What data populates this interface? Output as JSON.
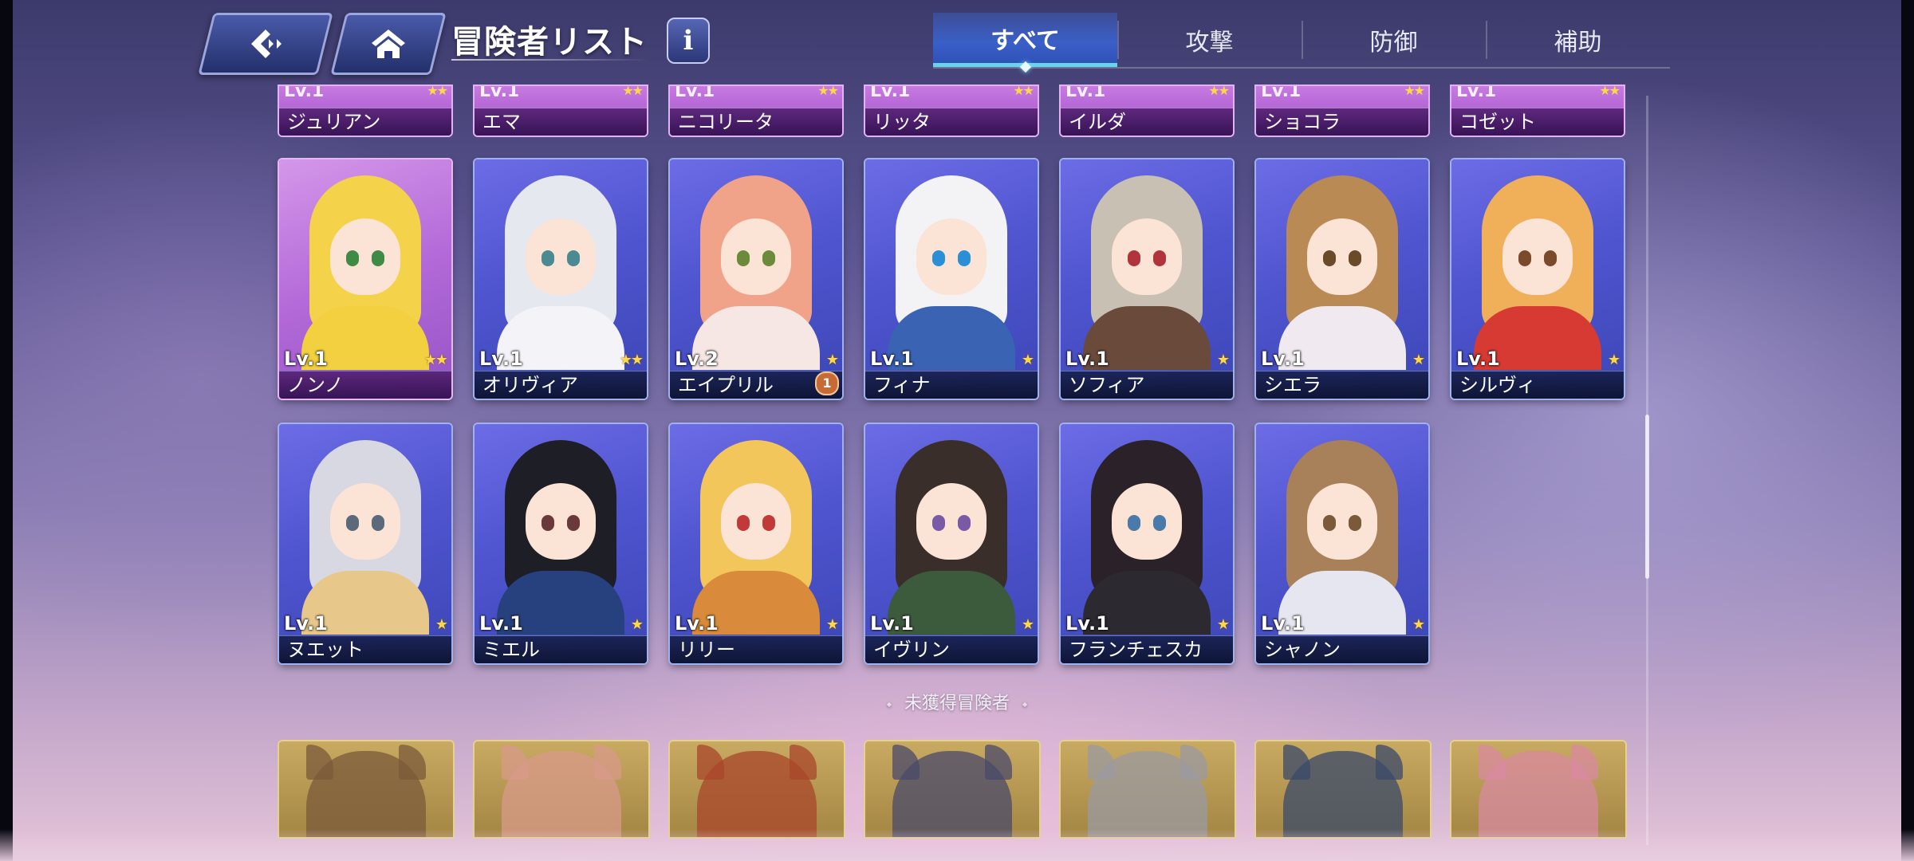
{
  "header": {
    "title": "冒険者リスト",
    "info_label": "i",
    "tabs": [
      {
        "label": "すべて",
        "active": true
      },
      {
        "label": "攻撃",
        "active": false
      },
      {
        "label": "防御",
        "active": false
      },
      {
        "label": "補助",
        "active": false
      }
    ]
  },
  "partial_row": [
    {
      "name": "ジュリアン",
      "level": "Lv.1",
      "stars": "★★"
    },
    {
      "name": "エマ",
      "level": "Lv.1",
      "stars": "★★"
    },
    {
      "name": "ニコリータ",
      "level": "Lv.1",
      "stars": "★★"
    },
    {
      "name": "リッタ",
      "level": "Lv.1",
      "stars": "★★"
    },
    {
      "name": "イルダ",
      "level": "Lv.1",
      "stars": "★★"
    },
    {
      "name": "ショコラ",
      "level": "Lv.1",
      "stars": "★★"
    },
    {
      "name": "コゼット",
      "level": "Lv.1",
      "stars": "★★"
    }
  ],
  "row1": [
    {
      "name": "ノンノ",
      "level": "Lv.1",
      "stars": "★★",
      "hair": "#f4d24a",
      "eye": "#3f8a44",
      "outfit": "#f2d040"
    },
    {
      "name": "オリヴィア",
      "level": "Lv.1",
      "stars": "★★",
      "hair": "#e6e8ef",
      "eye": "#4a8a92",
      "outfit": "#f4f4f8"
    },
    {
      "name": "エイプリル",
      "level": "Lv.2",
      "stars": "★",
      "badge": "1",
      "hair": "#f1a38a",
      "eye": "#6b8a3c",
      "outfit": "#f6e6e4"
    },
    {
      "name": "フィナ",
      "level": "Lv.1",
      "stars": "★",
      "hair": "#f3f3f6",
      "eye": "#2a8fd6",
      "outfit": "#3a63b4"
    },
    {
      "name": "ソフィア",
      "level": "Lv.1",
      "stars": "★",
      "hair": "#c9c0b4",
      "eye": "#b0343a",
      "outfit": "#6a4a3a"
    },
    {
      "name": "シエラ",
      "level": "Lv.1",
      "stars": "★",
      "hair": "#b98a54",
      "eye": "#6a4a28",
      "outfit": "#f0eaf0"
    },
    {
      "name": "シルヴィ",
      "level": "Lv.1",
      "stars": "★",
      "hair": "#f0b05a",
      "eye": "#7a4a2a",
      "outfit": "#d63a32"
    }
  ],
  "row2": [
    {
      "name": "ヌエット",
      "level": "Lv.1",
      "stars": "★",
      "hair": "#d8d8e2",
      "eye": "#5a6a7a",
      "outfit": "#e8c88a"
    },
    {
      "name": "ミエル",
      "level": "Lv.1",
      "stars": "★",
      "hair": "#1e1e26",
      "eye": "#6a3a3a",
      "outfit": "#27407e"
    },
    {
      "name": "リリー",
      "level": "Lv.1",
      "stars": "★",
      "hair": "#f2c65a",
      "eye": "#c03a3a",
      "outfit": "#d98a3a"
    },
    {
      "name": "イヴリン",
      "level": "Lv.1",
      "stars": "★",
      "hair": "#3a2e2a",
      "eye": "#7a5aa8",
      "outfit": "#3c5a3c"
    },
    {
      "name": "フランチェスカ",
      "level": "Lv.1",
      "stars": "★",
      "hair": "#2a2228",
      "eye": "#4a7aa8",
      "outfit": "#2c2a30"
    },
    {
      "name": "シャノン",
      "level": "Lv.1",
      "stars": "★",
      "hair": "#a8805a",
      "eye": "#7a5a3a",
      "outfit": "#e6e6f0"
    }
  ],
  "unacquired": {
    "label": "未獲得冒険者",
    "cards": [
      {
        "tint": "#7a5a3a"
      },
      {
        "tint": "#d89a8a"
      },
      {
        "tint": "#a8452a"
      },
      {
        "tint": "#4a4a6a"
      },
      {
        "tint": "#9a9aa0"
      },
      {
        "tint": "#3a4a6a"
      },
      {
        "tint": "#d88aa0"
      }
    ]
  },
  "colors": {
    "card_blue": "#4f55cf",
    "card_pink": "#b46ad8",
    "star": "#ffd74a",
    "active_tab_underline": "#6ad3ec",
    "locked_card": "#b8984f"
  }
}
